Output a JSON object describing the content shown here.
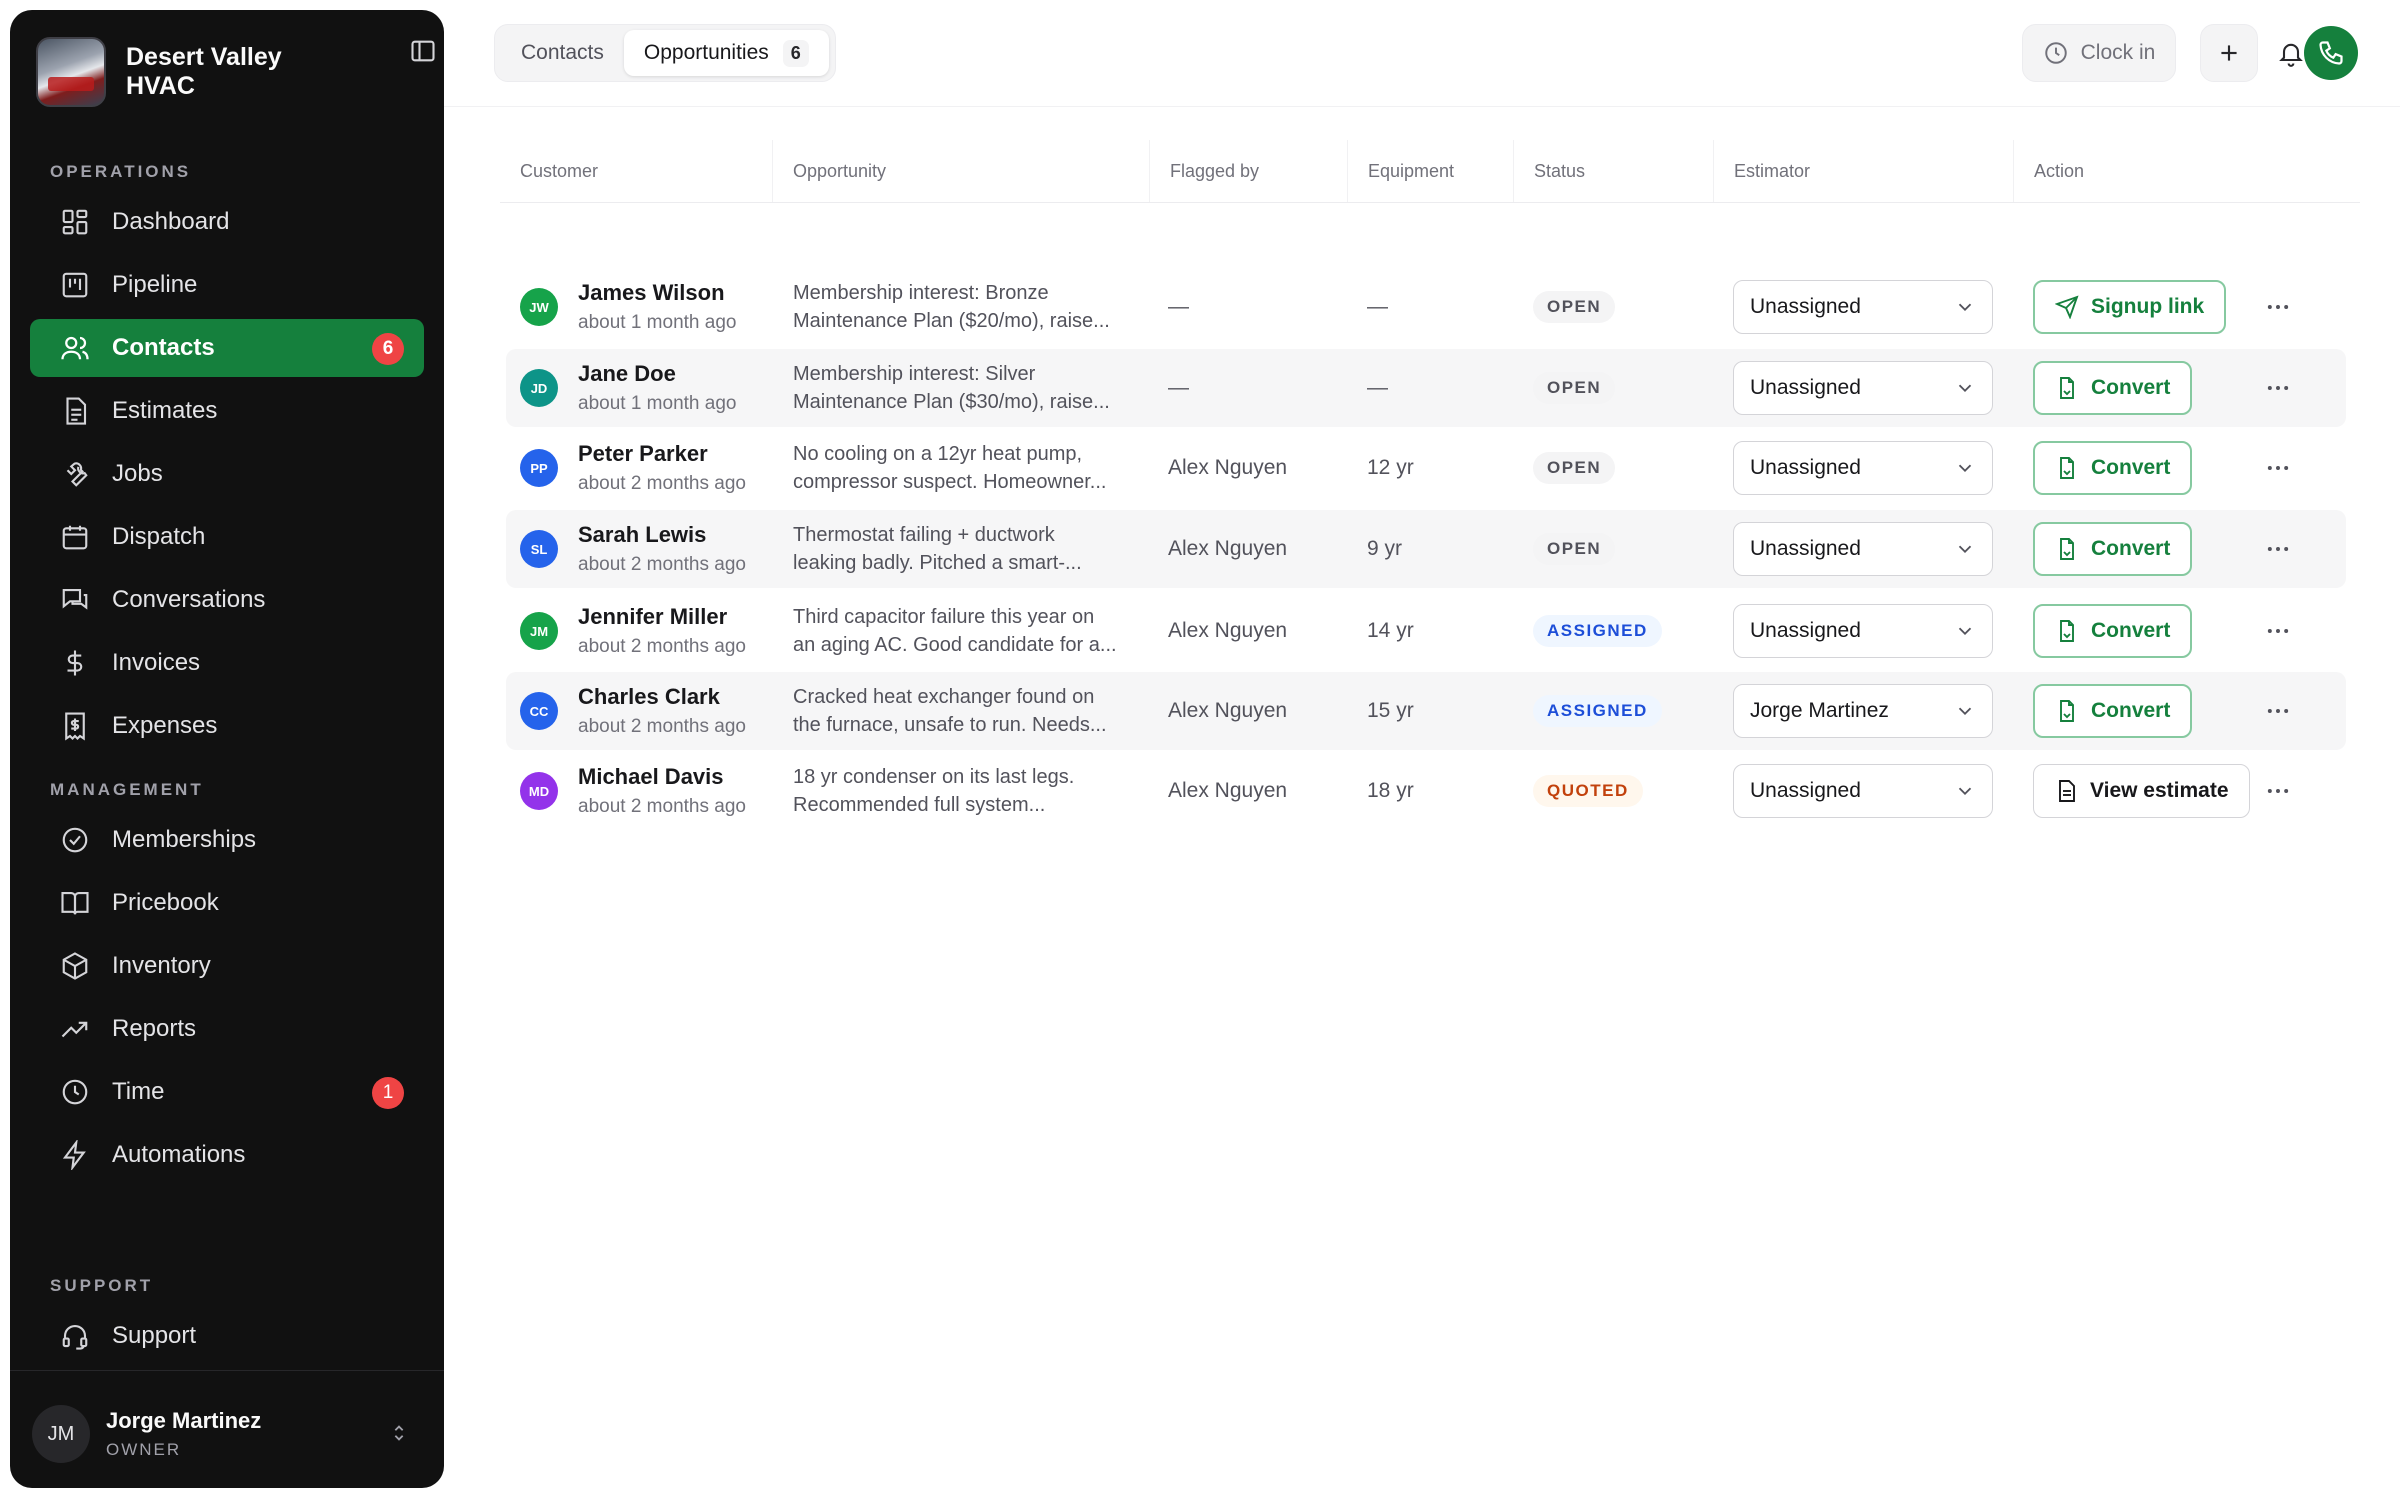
{
  "sidebar": {
    "brand_name": "Desert Valley HVAC",
    "sections": {
      "operations": "OPERATIONS",
      "management": "MANAGEMENT",
      "support": "SUPPORT"
    },
    "items": [
      {
        "key": "dashboard",
        "label": "Dashboard",
        "icon": "dashboard-icon"
      },
      {
        "key": "pipeline",
        "label": "Pipeline",
        "icon": "pipeline-icon"
      },
      {
        "key": "contacts",
        "label": "Contacts",
        "icon": "users-icon",
        "badge": "6",
        "active": true
      },
      {
        "key": "estimates",
        "label": "Estimates",
        "icon": "document-icon"
      },
      {
        "key": "jobs",
        "label": "Jobs",
        "icon": "wrench-icon"
      },
      {
        "key": "dispatch",
        "label": "Dispatch",
        "icon": "calendar-icon"
      },
      {
        "key": "conversations",
        "label": "Conversations",
        "icon": "chat-icon"
      },
      {
        "key": "invoices",
        "label": "Invoices",
        "icon": "dollar-icon"
      },
      {
        "key": "expenses",
        "label": "Expenses",
        "icon": "receipt-icon"
      },
      {
        "key": "memberships",
        "label": "Memberships",
        "icon": "badge-check-icon"
      },
      {
        "key": "pricebook",
        "label": "Pricebook",
        "icon": "book-icon"
      },
      {
        "key": "inventory",
        "label": "Inventory",
        "icon": "box-icon"
      },
      {
        "key": "reports",
        "label": "Reports",
        "icon": "trend-icon"
      },
      {
        "key": "time",
        "label": "Time",
        "icon": "clock-icon",
        "badge": "1"
      },
      {
        "key": "automations",
        "label": "Automations",
        "icon": "bolt-icon"
      },
      {
        "key": "support",
        "label": "Support",
        "icon": "headset-icon"
      }
    ],
    "user": {
      "initials": "JM",
      "name": "Jorge Martinez",
      "role": "OWNER"
    }
  },
  "topbar": {
    "tabs": [
      {
        "label": "Contacts"
      },
      {
        "label": "Opportunities",
        "count": "6",
        "active": true
      }
    ],
    "clock_in_label": "Clock in"
  },
  "table": {
    "columns": [
      "Customer",
      "Opportunity",
      "Flagged by",
      "Equipment",
      "Status",
      "Estimator",
      "Action"
    ],
    "rows": [
      {
        "initials": "JW",
        "avatar_color": "#16a34a",
        "name": "James Wilson",
        "time": "about 1 month ago",
        "opportunity_line1": "Membership interest: Bronze",
        "opportunity_line2": "Maintenance Plan ($20/mo), raise...",
        "flagged_by": "—",
        "equipment": "—",
        "status": "OPEN",
        "status_kind": "open",
        "estimator": "Unassigned",
        "action": "Signup link",
        "action_kind": "green",
        "action_icon": "send-icon"
      },
      {
        "initials": "JD",
        "avatar_color": "#0d9488",
        "name": "Jane Doe",
        "time": "about 1 month ago",
        "opportunity_line1": "Membership interest: Silver",
        "opportunity_line2": "Maintenance Plan ($30/mo), raise...",
        "flagged_by": "—",
        "equipment": "—",
        "status": "OPEN",
        "status_kind": "open",
        "estimator": "Unassigned",
        "action": "Convert",
        "action_kind": "green",
        "action_icon": "file-convert-icon"
      },
      {
        "initials": "PP",
        "avatar_color": "#2563eb",
        "name": "Peter Parker",
        "time": "about 2 months ago",
        "opportunity_line1": "No cooling on a 12yr heat pump,",
        "opportunity_line2": "compressor suspect. Homeowner...",
        "flagged_by": "Alex Nguyen",
        "equipment": "12 yr",
        "status": "OPEN",
        "status_kind": "open",
        "estimator": "Unassigned",
        "action": "Convert",
        "action_kind": "green",
        "action_icon": "file-convert-icon"
      },
      {
        "initials": "SL",
        "avatar_color": "#2563eb",
        "name": "Sarah Lewis",
        "time": "about 2 months ago",
        "opportunity_line1": "Thermostat failing + ductwork",
        "opportunity_line2": "leaking badly. Pitched a smart-...",
        "flagged_by": "Alex Nguyen",
        "equipment": "9 yr",
        "status": "OPEN",
        "status_kind": "open",
        "estimator": "Unassigned",
        "action": "Convert",
        "action_kind": "green",
        "action_icon": "file-convert-icon"
      },
      {
        "initials": "JM",
        "avatar_color": "#16a34a",
        "name": "Jennifer Miller",
        "time": "about 2 months ago",
        "opportunity_line1": "Third capacitor failure this year on",
        "opportunity_line2": "an aging AC. Good candidate for a...",
        "flagged_by": "Alex Nguyen",
        "equipment": "14 yr",
        "status": "ASSIGNED",
        "status_kind": "assigned",
        "estimator": "Unassigned",
        "action": "Convert",
        "action_kind": "green",
        "action_icon": "file-convert-icon"
      },
      {
        "initials": "CC",
        "avatar_color": "#2563eb",
        "name": "Charles Clark",
        "time": "about 2 months ago",
        "opportunity_line1": "Cracked heat exchanger found on",
        "opportunity_line2": "the furnace, unsafe to run. Needs...",
        "flagged_by": "Alex Nguyen",
        "equipment": "15 yr",
        "status": "ASSIGNED",
        "status_kind": "assigned",
        "estimator": "Jorge Martinez",
        "action": "Convert",
        "action_kind": "green",
        "action_icon": "file-convert-icon"
      },
      {
        "initials": "MD",
        "avatar_color": "#9333ea",
        "name": "Michael Davis",
        "time": "about 2 months ago",
        "opportunity_line1": "18 yr condenser on its last legs.",
        "opportunity_line2": "Recommended full system...",
        "flagged_by": "Alex Nguyen",
        "equipment": "18 yr",
        "status": "QUOTED",
        "status_kind": "quoted",
        "estimator": "Unassigned",
        "action": "View estimate",
        "action_kind": "neutral",
        "action_icon": "document-icon"
      }
    ]
  }
}
